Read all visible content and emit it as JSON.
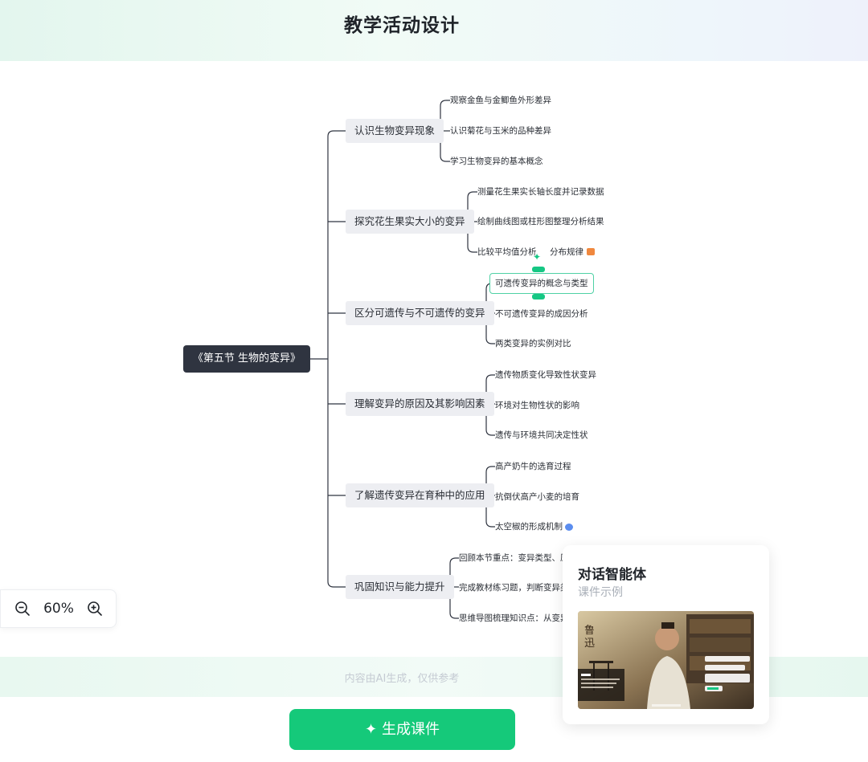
{
  "header": {
    "title": "教学活动设计"
  },
  "mindmap": {
    "root": "《第五节 生物的变异》",
    "branches": [
      {
        "label": "认识生物变异现象",
        "children": [
          "观察金鱼与金鲫鱼外形差异",
          "认识菊花与玉米的品种差异",
          "学习生物变异的基本概念"
        ]
      },
      {
        "label": "探究花生果实大小的变异",
        "children": [
          "测量花生果实长轴长度并记录数据",
          "绘制曲线图或柱形图整理分析结果",
          "比较平均值分析",
          "分布规律"
        ]
      },
      {
        "label": "区分可遗传与不可遗传的变异",
        "children": [
          "可遗传变异的概念与类型",
          "不可遗传变异的成因分析",
          "两类变异的实例对比"
        ]
      },
      {
        "label": "理解变异的原因及其影响因素",
        "children": [
          "遗传物质变化导致性状变异",
          "环境对生物性状的影响",
          "遗传与环境共同决定性状"
        ]
      },
      {
        "label": "了解遗传变异在育种中的应用",
        "children": [
          "高产奶牛的选育过程",
          "抗倒伏高产小麦的培育",
          "太空椒的形成机制"
        ]
      },
      {
        "label": "巩固知识与能力提升",
        "children": [
          "回顾本节重点：变异类型、原因",
          "完成教材练习题，判断变异类型",
          "思维导图梳理知识点：从变异"
        ]
      }
    ],
    "icons": {
      "sparkle": "sparkle-icon",
      "book_emoji": "book-emoji-icon",
      "chat_emoji": "chat-emoji-icon"
    }
  },
  "zoom": {
    "level": "60%",
    "zoom_out_icon": "zoom-out-icon",
    "zoom_in_icon": "zoom-in-icon"
  },
  "footer": {
    "disclaimer": "内容由AI生成，仅供参考",
    "generate_button": "生成课件"
  },
  "agent_card": {
    "title": "对话智能体",
    "subtitle": "课件示例",
    "thumbnail_caption": "鲁迅"
  },
  "colors": {
    "accent": "#15c97a",
    "root_bg": "#2f3440",
    "branch_bg": "#edeef2",
    "selected_border": "#4fd1a5"
  }
}
